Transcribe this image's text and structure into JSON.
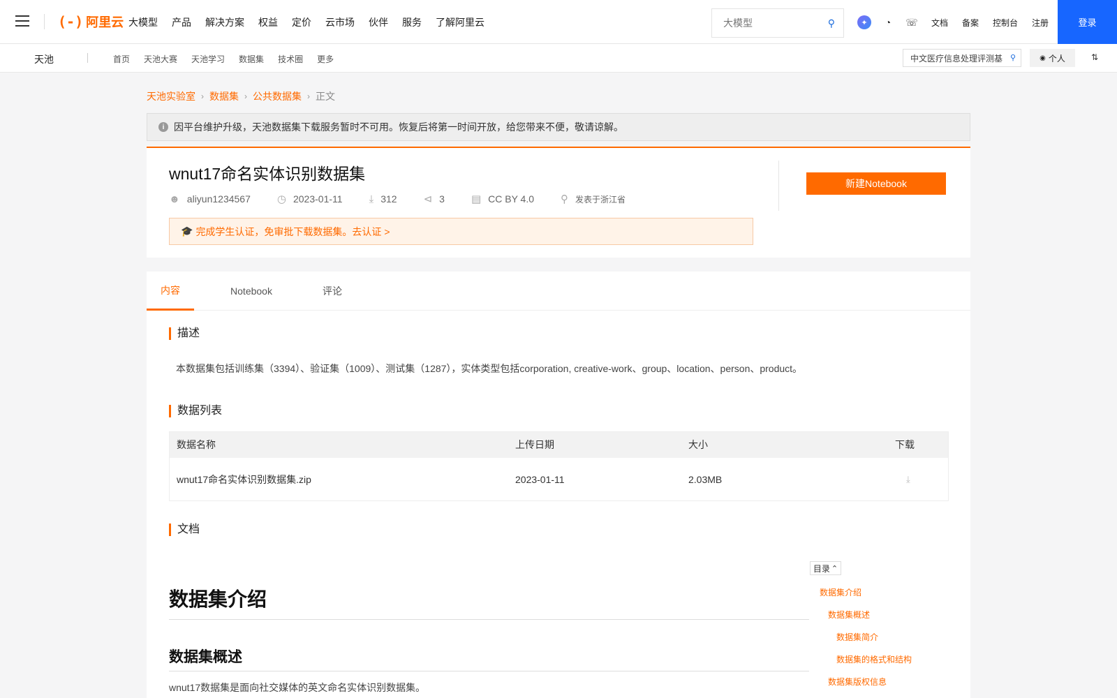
{
  "topbar": {
    "brand": "阿里云",
    "nav": [
      "大模型",
      "产品",
      "解决方案",
      "权益",
      "定价",
      "云市场",
      "伙伴",
      "服务",
      "了解阿里云"
    ],
    "search_placeholder": "大模型",
    "links": [
      "文档",
      "备案",
      "控制台",
      "注册"
    ],
    "login": "登录"
  },
  "subbar": {
    "title": "天池",
    "nav": [
      "首页",
      "天池大赛",
      "天池学习",
      "数据集",
      "技术圈",
      "更多"
    ],
    "search_value": "中文医疗信息处理评测基",
    "personal": "个人"
  },
  "breadcrumb": [
    "天池实验室",
    "数据集",
    "公共数据集",
    "正文"
  ],
  "notice": "因平台维护升级，天池数据集下载服务暂时不可用。恢复后将第一时间开放，给您带来不便，敬请谅解。",
  "dataset": {
    "title": "wnut17命名实体识别数据集",
    "author": "aliyun1234567",
    "date": "2023-01-11",
    "downloads": "312",
    "shares": "3",
    "license": "CC BY 4.0",
    "location": "发表于浙江省",
    "student_notice": "完成学生认证，免审批下载数据集。去认证 >",
    "notebook_button": "新建Notebook"
  },
  "tabs": [
    "内容",
    "Notebook",
    "评论"
  ],
  "sections": {
    "description_title": "描述",
    "description": "本数据集包括训练集（3394）、验证集（1009）、测试集（1287），实体类型包括corporation, creative-work、group、location、person、product。",
    "datalist_title": "数据列表",
    "docs_title": "文档"
  },
  "table": {
    "headers": [
      "数据名称",
      "上传日期",
      "大小",
      "下载"
    ],
    "rows": [
      {
        "name": "wnut17命名实体识别数据集.zip",
        "date": "2023-01-11",
        "size": "2.03MB"
      }
    ]
  },
  "doc": {
    "h1": "数据集介绍",
    "h2": "数据集概述",
    "p": "wnut17数据集是面向社交媒体的英文命名实体识别数据集。"
  },
  "toc": {
    "label": "目录",
    "items": [
      "数据集介绍",
      "数据集概述",
      "数据集简介",
      "数据集的格式和结构",
      "数据集版权信息"
    ]
  },
  "colors": {
    "accent": "#ff6a00",
    "login": "#1766ff"
  }
}
